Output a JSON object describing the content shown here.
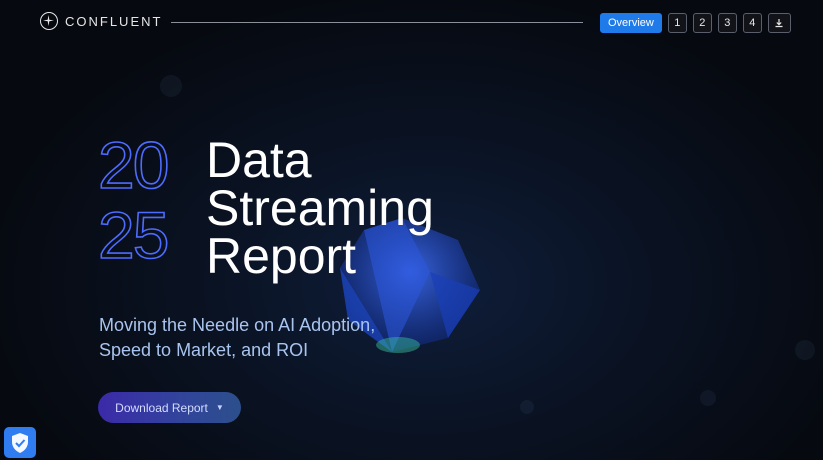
{
  "brand": {
    "name": "CONFLUENT",
    "icon": "confluent-logo-icon"
  },
  "nav": {
    "overview_label": "Overview",
    "pages": [
      "1",
      "2",
      "3",
      "4"
    ],
    "download_icon": "download-icon"
  },
  "hero": {
    "year_top": "20",
    "year_bottom": "25",
    "title_lines": [
      "Data",
      "Streaming",
      "Report"
    ],
    "subtitle_lines": [
      "Moving the Needle on AI Adoption,",
      "Speed to Market, and ROI"
    ],
    "cta_label": "Download Report",
    "cta_icon": "chevron-down-icon"
  },
  "badge": {
    "icon": "shield-check-icon"
  },
  "colors": {
    "accent": "#1f7bea",
    "year": "#4e6bff",
    "subtitle": "#a9c4ee"
  }
}
